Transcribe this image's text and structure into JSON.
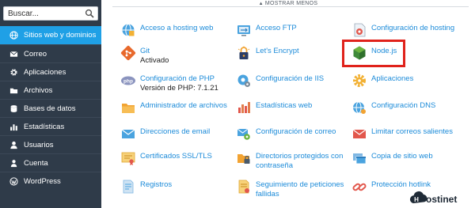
{
  "sidebar": {
    "search": {
      "placeholder": "Buscar..."
    },
    "items": [
      {
        "label": "Sitios web y dominios",
        "icon": "globe-icon",
        "active": true
      },
      {
        "label": "Correo",
        "icon": "mail-icon",
        "active": false
      },
      {
        "label": "Aplicaciones",
        "icon": "gear-icon",
        "active": false
      },
      {
        "label": "Archivos",
        "icon": "folder-icon",
        "active": false
      },
      {
        "label": "Bases de datos",
        "icon": "database-icon",
        "active": false
      },
      {
        "label": "Estadísticas",
        "icon": "bar-chart-icon",
        "active": false
      },
      {
        "label": "Usuarios",
        "icon": "user-icon",
        "active": false
      },
      {
        "label": "Cuenta",
        "icon": "account-icon",
        "active": false
      },
      {
        "label": "WordPress",
        "icon": "wordpress-icon",
        "active": false
      }
    ]
  },
  "main": {
    "show_less": "MOSTRAR MENOS",
    "tools": [
      {
        "label": "Acceso a hosting web",
        "icon": "hosting-access-icon"
      },
      {
        "label": "Acceso FTP",
        "icon": "ftp-icon"
      },
      {
        "label": "Configuración de hosting",
        "icon": "hosting-settings-icon"
      },
      {
        "label": "Git",
        "sub": "Activado",
        "icon": "git-icon"
      },
      {
        "label": "Let's Encrypt",
        "icon": "lets-encrypt-icon"
      },
      {
        "label": "Node.js",
        "icon": "nodejs-icon"
      },
      {
        "label": "Configuración de PHP",
        "sub": "Versión de PHP: 7.1.21",
        "icon": "php-icon"
      },
      {
        "label": "Configuración de IIS",
        "icon": "iis-icon"
      },
      {
        "label": "Aplicaciones",
        "icon": "applications-icon"
      },
      {
        "label": "Administrador de archivos",
        "icon": "file-manager-icon"
      },
      {
        "label": "Estadísticas web",
        "icon": "web-stats-icon"
      },
      {
        "label": "Configuración DNS",
        "icon": "dns-icon"
      },
      {
        "label": "Direcciones de email",
        "icon": "email-addresses-icon"
      },
      {
        "label": "Configuración de correo",
        "icon": "mail-settings-icon"
      },
      {
        "label": "Limitar correos salientes",
        "icon": "limit-mail-icon"
      },
      {
        "label": "Certificados SSL/TLS",
        "icon": "ssl-certificate-icon"
      },
      {
        "label": "Directorios protegidos con contraseña",
        "label_lines": [
          "Directorios protegidos con",
          "contraseña"
        ],
        "icon": "protected-dirs-icon"
      },
      {
        "label": "Copia de sitio web",
        "icon": "website-copy-icon"
      },
      {
        "label": "Registros",
        "icon": "logs-icon"
      },
      {
        "label": "Seguimiento de peticiones fallidas",
        "label_lines": [
          "Seguimiento de peticiones",
          "fallidas"
        ],
        "icon": "failed-requests-icon"
      },
      {
        "label": "Protección hotlink",
        "icon": "hotlink-protection-icon"
      }
    ]
  },
  "watermark": {
    "text": "Hostinet"
  },
  "colors": {
    "sidebar_bg": "#2f3b49",
    "active_item": "#1fa0e6",
    "link": "#1c8bd9",
    "highlight": "#e0221b"
  }
}
